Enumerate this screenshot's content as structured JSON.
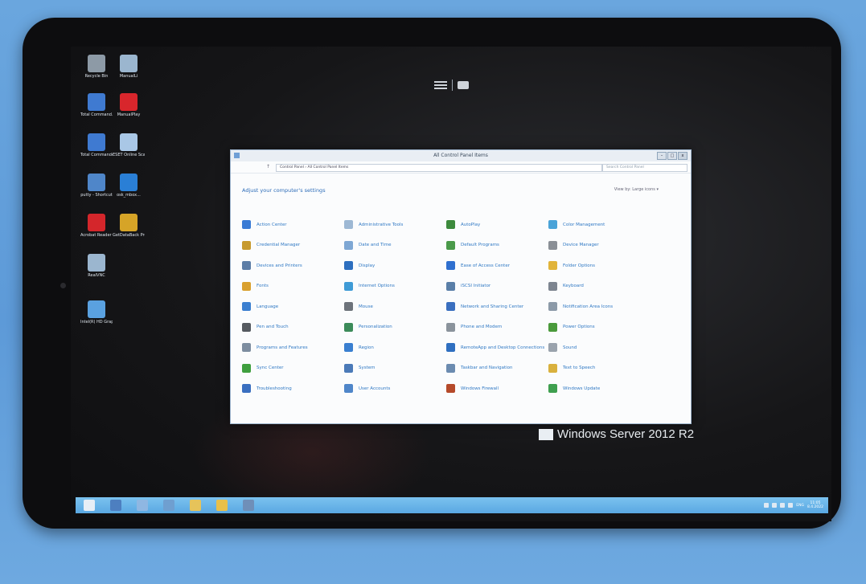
{
  "desktop_icons": [
    {
      "label": "Recycle Bin",
      "color": "#8d9aa6"
    },
    {
      "label": "ManualLi",
      "color": "#9bb6cf"
    },
    {
      "label": "Total Command...",
      "color": "#3f7ad1"
    },
    {
      "label": "ManualPlay",
      "color": "#d8262c"
    },
    {
      "label": "Total Commander",
      "color": "#3f7ad1"
    },
    {
      "label": "ESET Online Scanner",
      "color": "#a9c7e6"
    },
    {
      "label": "putty - Shortcut",
      "color": "#4f86c9"
    },
    {
      "label": "osk_mbox...",
      "color": "#2a7fd6"
    },
    {
      "label": "Acrobat Reader DC",
      "color": "#d4262b"
    },
    {
      "label": "GetDataBack Pro",
      "color": "#d6a427"
    },
    {
      "label": "RealVNC",
      "color": "#9bb6cf"
    },
    {
      "label": "Intel(R) HD Graphic...",
      "color": "#5aa1e0"
    }
  ],
  "window": {
    "title": "All Control Panel Items",
    "address": "Control Panel  ›  All Control Panel Items",
    "search_placeholder": "Search Control Panel",
    "heading": "Adjust your computer's settings",
    "view_by": "View by:  Large icons ▾",
    "buttons": {
      "minimize": "–",
      "maximize": "□",
      "close": "x"
    }
  },
  "items": [
    [
      {
        "label": "Action Center",
        "color": "#3a7bd5"
      },
      {
        "label": "Administrative Tools",
        "color": "#9db8d4"
      },
      {
        "label": "AutoPlay",
        "color": "#3d8a3d"
      },
      {
        "label": "Color Management",
        "color": "#4aa3d8"
      }
    ],
    [
      {
        "label": "Credential Manager",
        "color": "#c79a2e"
      },
      {
        "label": "Date and Time",
        "color": "#7ea7d4"
      },
      {
        "label": "Default Programs",
        "color": "#4a9a4a"
      },
      {
        "label": "Device Manager",
        "color": "#8a8f96"
      }
    ],
    [
      {
        "label": "Devices and Printers",
        "color": "#5c7da6"
      },
      {
        "label": "Display",
        "color": "#2d6fbf"
      },
      {
        "label": "Ease of Access Center",
        "color": "#2f6fcf"
      },
      {
        "label": "Folder Options",
        "color": "#e1b43a"
      }
    ],
    [
      {
        "label": "Fonts",
        "color": "#d9a02e"
      },
      {
        "label": "Internet Options",
        "color": "#3f9bd6"
      },
      {
        "label": "iSCSI Initiator",
        "color": "#5a7fa8"
      },
      {
        "label": "Keyboard",
        "color": "#7d8590"
      }
    ],
    [
      {
        "label": "Language",
        "color": "#3b7fd0"
      },
      {
        "label": "Mouse",
        "color": "#6d737b"
      },
      {
        "label": "Network and Sharing Center",
        "color": "#3a6fbf"
      },
      {
        "label": "Notification Area Icons",
        "color": "#8c9aa8"
      }
    ],
    [
      {
        "label": "Pen and Touch",
        "color": "#555a60"
      },
      {
        "label": "Personalization",
        "color": "#3c8b5a"
      },
      {
        "label": "Phone and Modem",
        "color": "#8a939c"
      },
      {
        "label": "Power Options",
        "color": "#4a9a3c"
      }
    ],
    [
      {
        "label": "Programs and Features",
        "color": "#7d8da0"
      },
      {
        "label": "Region",
        "color": "#3a7fd0"
      },
      {
        "label": "RemoteApp and Desktop Connections",
        "color": "#2f6fc0"
      },
      {
        "label": "Sound",
        "color": "#9aa3ad"
      }
    ],
    [
      {
        "label": "Sync Center",
        "color": "#3f9f3f"
      },
      {
        "label": "System",
        "color": "#4b7ab8"
      },
      {
        "label": "Taskbar and Navigation",
        "color": "#6b8bb0"
      },
      {
        "label": "Text to Speech",
        "color": "#d9b13e"
      }
    ],
    [
      {
        "label": "Troubleshooting",
        "color": "#3a6fc0"
      },
      {
        "label": "User Accounts",
        "color": "#4f86c9"
      },
      {
        "label": "Windows Firewall",
        "color": "#b54a2a"
      },
      {
        "label": "Windows Update",
        "color": "#3f9f4f"
      }
    ]
  ],
  "watermark": "Windows Server 2012 R2",
  "taskbar": {
    "icons": [
      {
        "name": "start-icon",
        "color": "#e7eef6"
      },
      {
        "name": "server-manager-icon",
        "color": "#4d7fc0"
      },
      {
        "name": "powershell-icon",
        "color": "#8fb7e2"
      },
      {
        "name": "explorer-icon",
        "color": "#6f9fd0"
      },
      {
        "name": "folder-icon",
        "color": "#e6c35a"
      },
      {
        "name": "ie-icon",
        "color": "#e9c04a"
      },
      {
        "name": "control-panel-icon",
        "color": "#6f8fb8"
      }
    ],
    "lang": "ENG",
    "time": "11:05",
    "date": "8.4.2022"
  }
}
